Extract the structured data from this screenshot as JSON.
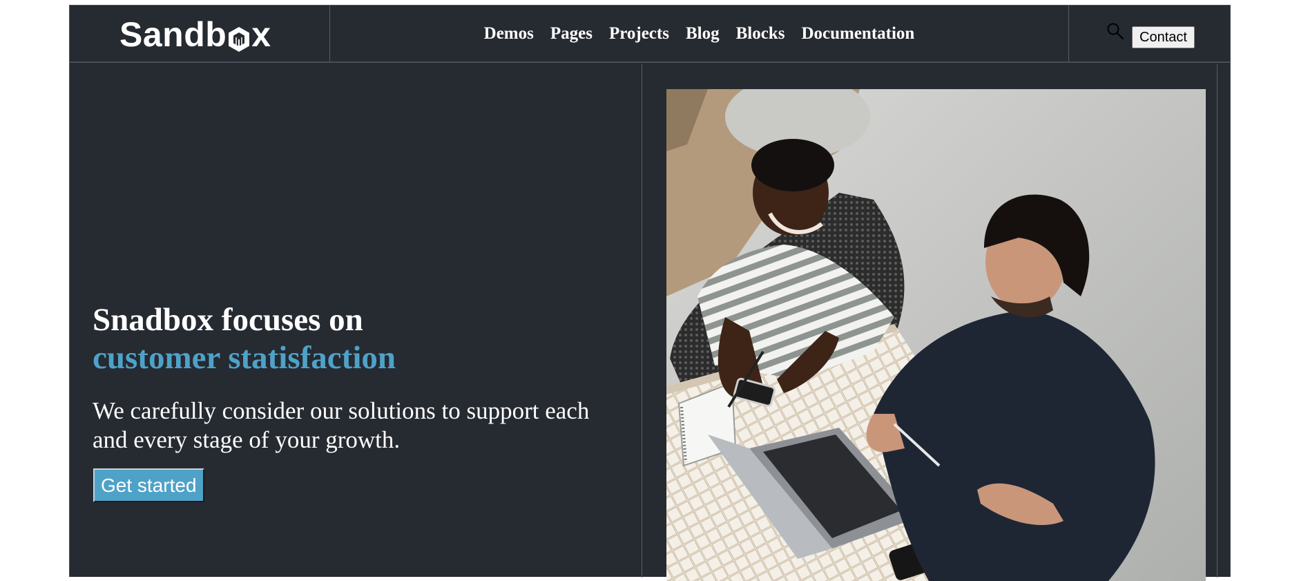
{
  "header": {
    "logo_text_before": "Sandb",
    "logo_text_after": "x",
    "nav": [
      {
        "label": "Demos"
      },
      {
        "label": "Pages"
      },
      {
        "label": "Projects"
      },
      {
        "label": "Blog"
      },
      {
        "label": "Blocks"
      },
      {
        "label": "Documentation"
      }
    ],
    "search_icon": "search-icon",
    "contact_label": "Contact"
  },
  "hero": {
    "title_line1": "Snadbox focuses on",
    "title_line2": "customer statisfaction",
    "subtitle": "We carefully consider our solutions to support each and every stage of your growth.",
    "cta_label": "Get started",
    "image_icon": "photo-two-people-at-cafe-table"
  },
  "colors": {
    "background": "#262a31",
    "accent": "#4ea2c8",
    "text": "#ffffff"
  }
}
